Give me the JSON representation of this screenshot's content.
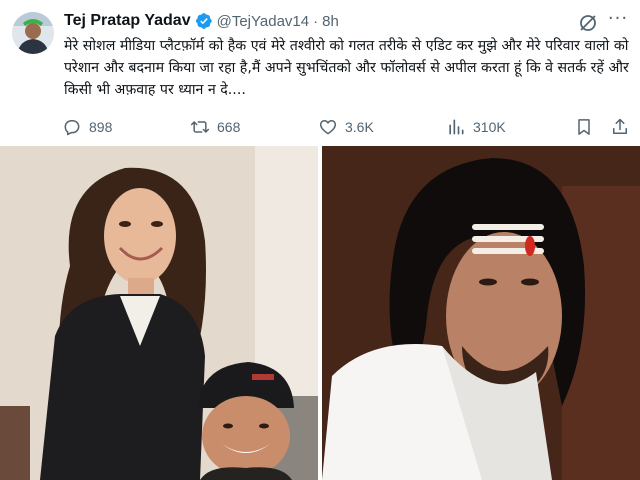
{
  "tweet": {
    "author_name": "Tej Pratap Yadav",
    "handle": "@TejYadav14",
    "separator": "·",
    "time": "8h",
    "text": "मेरे सोशल मीडिया प्लैटफ़ॉर्म को हैक एवं मेरे तश्वीरो को गलत तरीके से एडिट कर मुझे और मेरे परिवार वालो को परेशान और बदनाम किया जा रहा है,मैं अपने सुभचिंतको और फॉलोवर्स से अपील करता हूं कि वे सतर्क रहें और किसी भी अफ़वाह पर ध्यान न दे....",
    "stats": {
      "replies": "898",
      "reposts": "668",
      "likes": "3.6K",
      "views": "310K"
    }
  },
  "icons": {
    "verified": "verified-badge-icon",
    "grok": "grok-icon",
    "more": "more-icon",
    "reply": "reply-icon",
    "repost": "repost-icon",
    "like": "heart-icon",
    "views": "views-chart-icon",
    "bookmark": "bookmark-icon",
    "share": "share-icon"
  },
  "colors": {
    "text": "#0f1419",
    "muted": "#536471",
    "verified": "#1d9bf0"
  }
}
